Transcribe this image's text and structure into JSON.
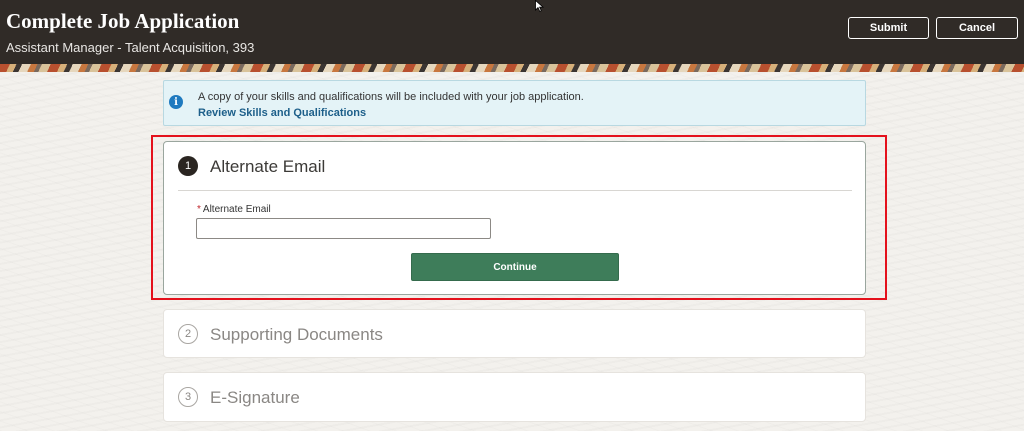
{
  "header": {
    "title": "Complete Job Application",
    "subtitle": "Assistant Manager - Talent Acquisition, 393",
    "submit_label": "Submit",
    "cancel_label": "Cancel"
  },
  "info": {
    "icon": "info-icon",
    "message": "A copy of your skills and qualifications will be included with your job application.",
    "link_label": "Review Skills and Qualifications"
  },
  "steps": [
    {
      "number": "1",
      "title": "Alternate Email",
      "active": true,
      "field": {
        "required_marker": "*",
        "label": "Alternate Email",
        "value": "",
        "placeholder": ""
      },
      "continue_label": "Continue"
    },
    {
      "number": "2",
      "title": "Supporting Documents",
      "active": false
    },
    {
      "number": "3",
      "title": "E-Signature",
      "active": false
    }
  ],
  "colors": {
    "header_bg": "#302b27",
    "info_bg": "#e4f3f7",
    "info_icon": "#1f7abf",
    "link": "#1d5f8a",
    "continue_bg": "#3e7d5a",
    "highlight": "#e4111c"
  }
}
